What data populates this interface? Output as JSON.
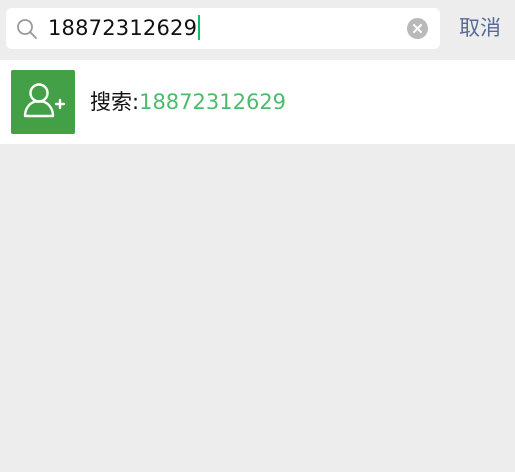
{
  "search": {
    "query": "18872312629",
    "cancel_label": "取消"
  },
  "result": {
    "prefix": "搜索:",
    "query": "18872312629",
    "icon": "add-contact-icon"
  },
  "colors": {
    "background": "#ededed",
    "accent_green": "#4cbb6c",
    "avatar_green": "#43a047",
    "cancel_blue": "#576b95"
  }
}
